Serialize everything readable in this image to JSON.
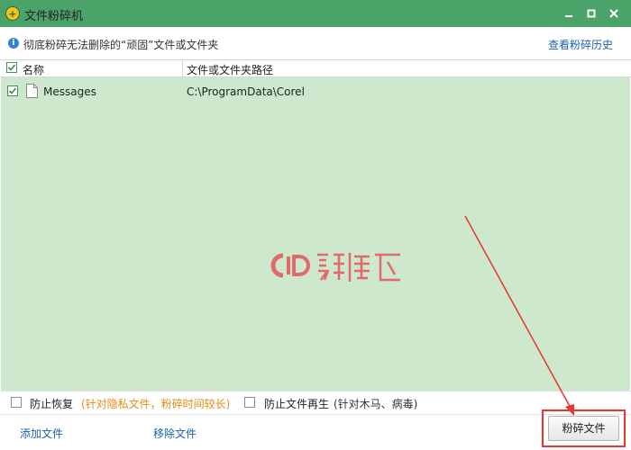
{
  "window": {
    "title": "文件粉碎机",
    "icon": "shredder-app-icon",
    "controls": [
      "minimize-icon",
      "maximize-icon",
      "close-icon"
    ],
    "title_bar_color": "#4ba36a"
  },
  "info": {
    "icon": "info-icon",
    "text": "彻底粉碎无法删除的“顽固”文件或文件夹",
    "history_link": "查看粉碎历史"
  },
  "table": {
    "headers": {
      "name": "名称",
      "path": "文件或文件夹路径"
    },
    "rows": [
      {
        "checked": true,
        "icon": "file-icon",
        "name": "Messages",
        "path": "C:\\ProgramData\\Corel"
      }
    ],
    "list_background": "#cde8cd"
  },
  "watermark": {
    "logo": "site-watermark-logo"
  },
  "options": {
    "prevent_recovery": {
      "checked": false,
      "label": "防止恢复",
      "note": "(针对隐私文件，粉碎时间较长)"
    },
    "prevent_regeneration": {
      "checked": false,
      "label": "防止文件再生",
      "note": "(针对木马、病毒)"
    }
  },
  "actions": {
    "add_file": "添加文件",
    "remove_file": "移除文件",
    "shred_file": "粉碎文件"
  },
  "annotation": {
    "highlight_color": "#e8352d",
    "arrow": "red-arrow-to-shred-button"
  }
}
